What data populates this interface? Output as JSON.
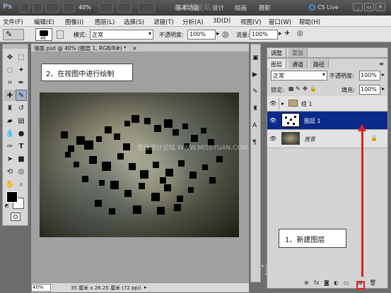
{
  "app": {
    "logo": "Ps",
    "zoom": "40%",
    "cs_live": "CS Live"
  },
  "top_menu": [
    "基本功能",
    "设计",
    "绘画",
    "摄影"
  ],
  "menu": [
    "文件(F)",
    "编辑(E)",
    "图像(I)",
    "图层(L)",
    "选择(S)",
    "滤镜(T)",
    "分析(A)",
    "3D(D)",
    "视图(V)",
    "窗口(W)",
    "帮助(H)"
  ],
  "options": {
    "brush_size": "46",
    "mode_label": "模式:",
    "mode_value": "正常",
    "opacity_label": "不透明度:",
    "opacity_value": "100%",
    "flow_label": "流量:",
    "flow_value": "100%"
  },
  "document": {
    "tab_title": "墙面.psd @ 40% (图层 1, RGB/8#) *",
    "status_zoom": "40%",
    "status_info": "35 厘米 x 26.25 厘米 (72 ppi)"
  },
  "callouts": {
    "draw": "2、在视图中进行绘制",
    "new_layer": "1、新建图层"
  },
  "watermarks": {
    "top": "PS教程论坛",
    "middle": "思缘设计论坛 WWW.MISSYUAN.COM",
    "bottom": "TLVI.NET"
  },
  "panel": {
    "tabs_top": [
      "调整",
      "蒙版"
    ],
    "tabs": [
      "图层",
      "通道",
      "路径"
    ],
    "blend_mode": "正常",
    "opacity_label": "不透明度:",
    "opacity_value": "100%",
    "lock_label": "锁定:",
    "fill_label": "填充:",
    "fill_value": "100%",
    "layers": [
      {
        "name": "组 1",
        "kind": "group"
      },
      {
        "name": "图层 1",
        "kind": "layer",
        "selected": true
      },
      {
        "name": "背景",
        "kind": "background",
        "locked": true
      }
    ]
  },
  "colors": {
    "selection": "#0a2a8a",
    "arrow": "#e02020",
    "foreground": "#000000",
    "background": "#ffffff"
  }
}
